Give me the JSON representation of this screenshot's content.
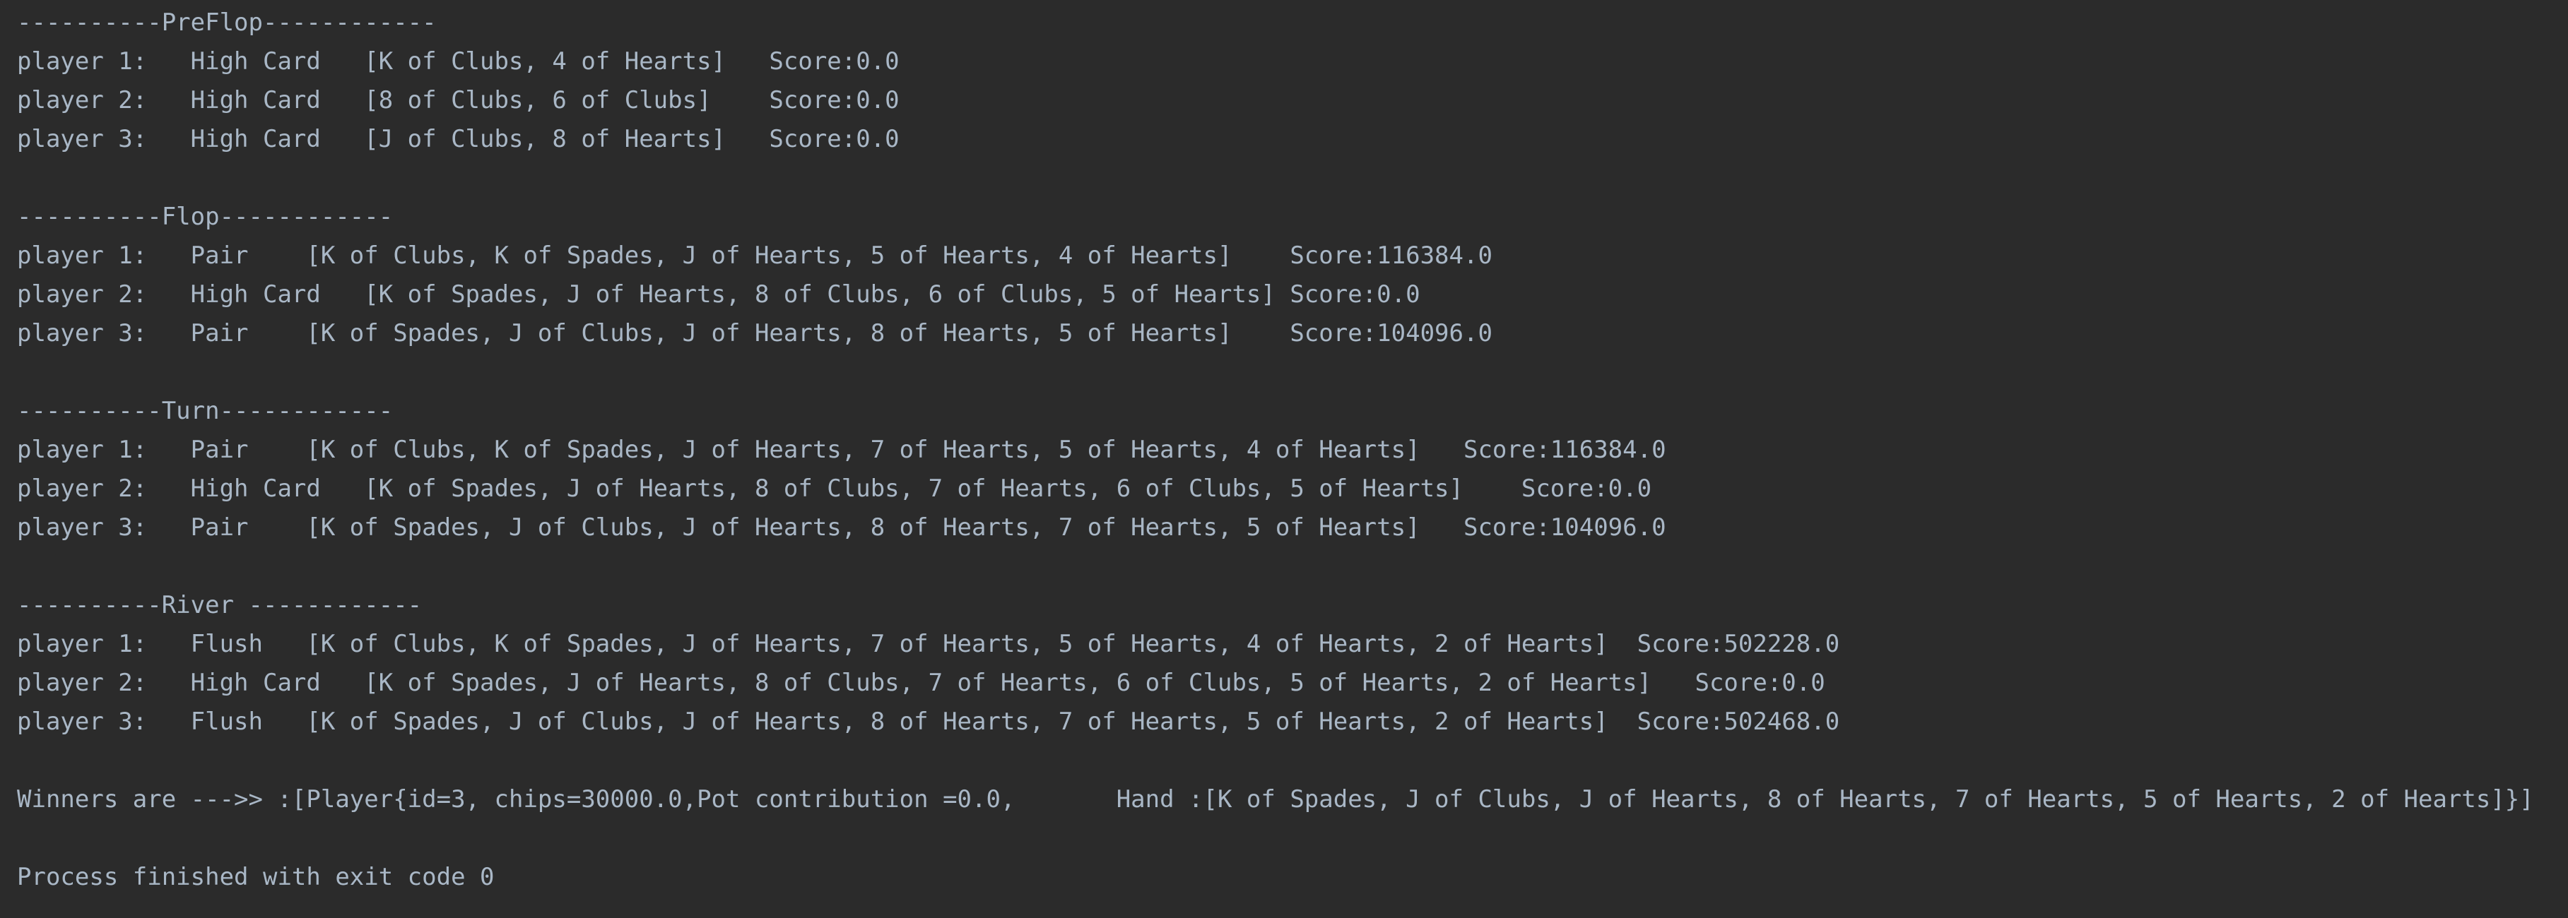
{
  "console": {
    "lines": [
      "----------PreFlop------------",
      "player 1:   High Card   [K of Clubs, 4 of Hearts]   Score:0.0",
      "player 2:   High Card   [8 of Clubs, 6 of Clubs]    Score:0.0",
      "player 3:   High Card   [J of Clubs, 8 of Hearts]   Score:0.0",
      "",
      "----------Flop------------",
      "player 1:   Pair    [K of Clubs, K of Spades, J of Hearts, 5 of Hearts, 4 of Hearts]    Score:116384.0",
      "player 2:   High Card   [K of Spades, J of Hearts, 8 of Clubs, 6 of Clubs, 5 of Hearts] Score:0.0",
      "player 3:   Pair    [K of Spades, J of Clubs, J of Hearts, 8 of Hearts, 5 of Hearts]    Score:104096.0",
      "",
      "----------Turn------------",
      "player 1:   Pair    [K of Clubs, K of Spades, J of Hearts, 7 of Hearts, 5 of Hearts, 4 of Hearts]   Score:116384.0",
      "player 2:   High Card   [K of Spades, J of Hearts, 8 of Clubs, 7 of Hearts, 6 of Clubs, 5 of Hearts]    Score:0.0",
      "player 3:   Pair    [K of Spades, J of Clubs, J of Hearts, 8 of Hearts, 7 of Hearts, 5 of Hearts]   Score:104096.0",
      "",
      "----------River ------------",
      "player 1:   Flush   [K of Clubs, K of Spades, J of Hearts, 7 of Hearts, 5 of Hearts, 4 of Hearts, 2 of Hearts]  Score:502228.0",
      "player 2:   High Card   [K of Spades, J of Hearts, 8 of Clubs, 7 of Hearts, 6 of Clubs, 5 of Hearts, 2 of Hearts]   Score:0.0",
      "player 3:   Flush   [K of Spades, J of Clubs, J of Hearts, 8 of Hearts, 7 of Hearts, 5 of Hearts, 2 of Hearts]  Score:502468.0",
      "",
      "Winners are --->> :[Player{id=3, chips=30000.0,Pot contribution =0.0,       Hand :[K of Spades, J of Clubs, J of Hearts, 8 of Hearts, 7 of Hearts, 5 of Hearts, 2 of Hearts]}]",
      "",
      "Process finished with exit code 0"
    ]
  },
  "colors": {
    "background": "#2b2b2b",
    "text": "#a9b7c6"
  }
}
